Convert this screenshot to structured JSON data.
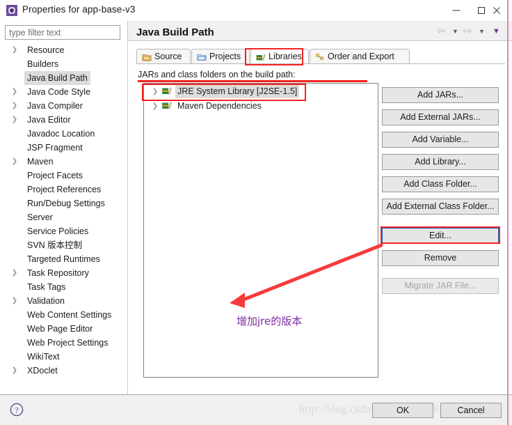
{
  "window": {
    "title": "Properties for app-base-v3",
    "icon": "properties-gear-icon",
    "minimize_label": "minimize",
    "maximize_label": "maximize",
    "close_label": "close"
  },
  "filter": {
    "placeholder": "type filter text",
    "value": ""
  },
  "sidebar": {
    "items": [
      {
        "label": "Resource",
        "expandable": true,
        "selected": false
      },
      {
        "label": "Builders",
        "expandable": false,
        "selected": false
      },
      {
        "label": "Java Build Path",
        "expandable": false,
        "selected": true
      },
      {
        "label": "Java Code Style",
        "expandable": true,
        "selected": false
      },
      {
        "label": "Java Compiler",
        "expandable": true,
        "selected": false
      },
      {
        "label": "Java Editor",
        "expandable": true,
        "selected": false
      },
      {
        "label": "Javadoc Location",
        "expandable": false,
        "selected": false
      },
      {
        "label": "JSP Fragment",
        "expandable": false,
        "selected": false
      },
      {
        "label": "Maven",
        "expandable": true,
        "selected": false
      },
      {
        "label": "Project Facets",
        "expandable": false,
        "selected": false
      },
      {
        "label": "Project References",
        "expandable": false,
        "selected": false
      },
      {
        "label": "Run/Debug Settings",
        "expandable": false,
        "selected": false
      },
      {
        "label": "Server",
        "expandable": false,
        "selected": false
      },
      {
        "label": "Service Policies",
        "expandable": false,
        "selected": false
      },
      {
        "label": "SVN 版本控制",
        "expandable": false,
        "selected": false
      },
      {
        "label": "Targeted Runtimes",
        "expandable": false,
        "selected": false
      },
      {
        "label": "Task Repository",
        "expandable": true,
        "selected": false
      },
      {
        "label": "Task Tags",
        "expandable": false,
        "selected": false
      },
      {
        "label": "Validation",
        "expandable": true,
        "selected": false
      },
      {
        "label": "Web Content Settings",
        "expandable": false,
        "selected": false
      },
      {
        "label": "Web Page Editor",
        "expandable": false,
        "selected": false
      },
      {
        "label": "Web Project Settings",
        "expandable": false,
        "selected": false
      },
      {
        "label": "WikiText",
        "expandable": false,
        "selected": false
      },
      {
        "label": "XDoclet",
        "expandable": true,
        "selected": false
      }
    ]
  },
  "page": {
    "title": "Java Build Path",
    "nav": {
      "back_icon": "back-arrow-icon",
      "back_menu_icon": "chevron-down-icon",
      "forward_icon": "forward-arrow-icon",
      "forward_menu_icon": "chevron-down-icon",
      "view_menu_icon": "chevron-down-icon"
    },
    "tabs": [
      {
        "label": "Source",
        "icon": "source-folder-icon",
        "active": false
      },
      {
        "label": "Projects",
        "icon": "projects-folder-icon",
        "active": false
      },
      {
        "label": "Libraries",
        "icon": "libraries-books-icon",
        "active": true
      },
      {
        "label": "Order and Export",
        "icon": "order-export-icon",
        "active": false
      }
    ],
    "section_label": "JARs and class folders on the build path:",
    "entries": [
      {
        "label": "JRE System Library [J2SE-1.5]",
        "icon": "library-books-icon",
        "expandable": true,
        "selected": true
      },
      {
        "label": "Maven Dependencies",
        "icon": "library-books-icon",
        "expandable": true,
        "selected": false
      }
    ],
    "side_buttons": [
      {
        "label": "Add JARs...",
        "enabled": true,
        "focused": false
      },
      {
        "label": "Add External JARs...",
        "enabled": true,
        "focused": false
      },
      {
        "label": "Add Variable...",
        "enabled": true,
        "focused": false
      },
      {
        "label": "Add Library...",
        "enabled": true,
        "focused": false
      },
      {
        "label": "Add Class Folder...",
        "enabled": true,
        "focused": false
      },
      {
        "label": "Add External Class Folder...",
        "enabled": true,
        "focused": false
      },
      {
        "label": "Edit...",
        "enabled": true,
        "focused": true
      },
      {
        "label": "Remove",
        "enabled": true,
        "focused": false
      },
      {
        "label": "Migrate JAR File...",
        "enabled": false,
        "focused": false
      }
    ]
  },
  "footer": {
    "help_icon": "help-question-icon",
    "ok_label": "OK",
    "cancel_label": "Cancel",
    "watermark": "http://blog.csdn.net/pengy_1801"
  },
  "annotations": {
    "note_text": "增加jre的版本",
    "note_color": "#7b2d9e",
    "highlight_color": "#f22222",
    "focus_color": "#0a64c8"
  }
}
